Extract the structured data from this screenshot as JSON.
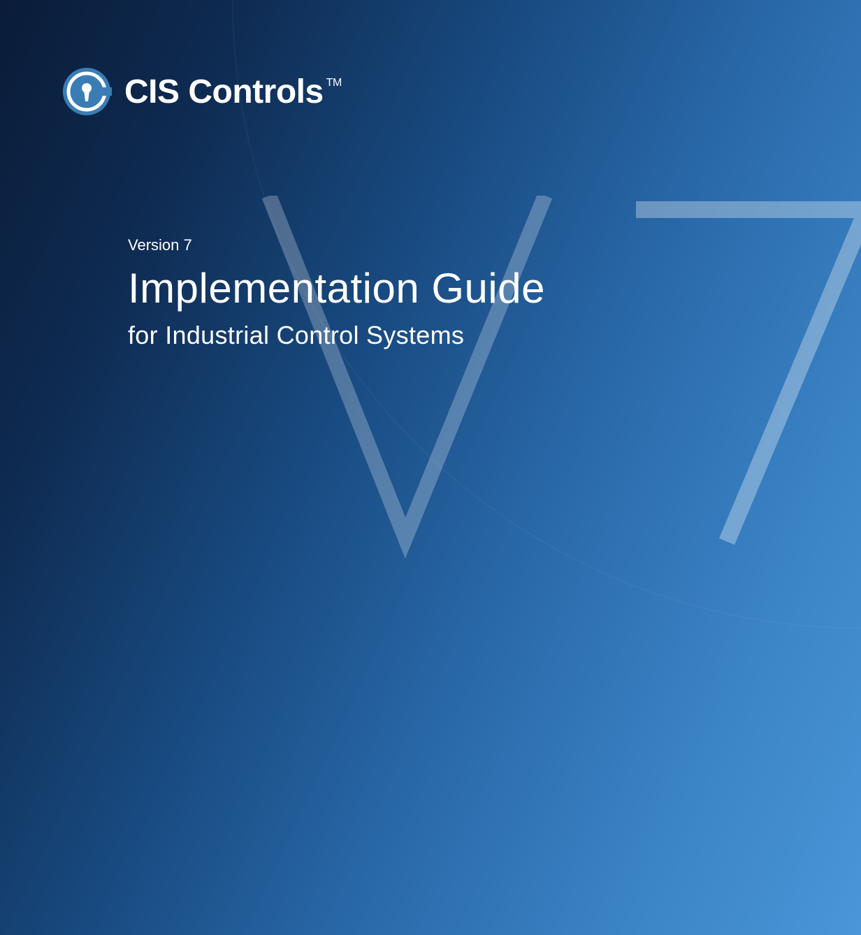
{
  "brand": {
    "name": "CIS Controls",
    "trademark": "TM"
  },
  "document": {
    "version_label": "Version 7",
    "title": "Implementation Guide",
    "subtitle": "for Industrial Control Systems"
  },
  "watermark": {
    "text": "V7"
  }
}
